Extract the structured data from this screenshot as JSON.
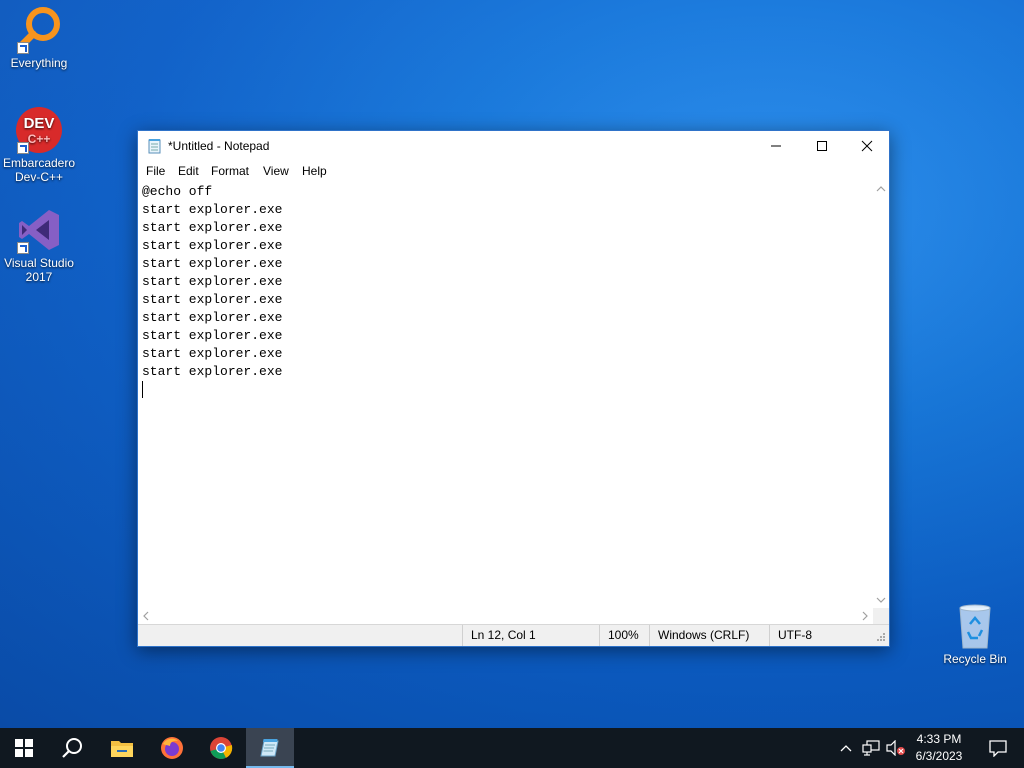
{
  "desktop": {
    "icons": [
      {
        "label": "Everything"
      },
      {
        "label": "Embarcadero Dev-C++"
      },
      {
        "label": "Visual Studio 2017"
      },
      {
        "label": "Recycle Bin"
      }
    ]
  },
  "notepad": {
    "title": "*Untitled - Notepad",
    "menu": [
      "File",
      "Edit",
      "Format",
      "View",
      "Help"
    ],
    "lines": [
      "@echo off",
      "start explorer.exe",
      "start explorer.exe",
      "start explorer.exe",
      "start explorer.exe",
      "start explorer.exe",
      "start explorer.exe",
      "start explorer.exe",
      "start explorer.exe",
      "start explorer.exe",
      "start explorer.exe"
    ],
    "status": {
      "position": "Ln 12, Col 1",
      "zoom": "100%",
      "line_ending": "Windows (CRLF)",
      "encoding": "UTF-8"
    }
  },
  "taskbar": {
    "time": "4:33 PM",
    "date": "6/3/2023"
  },
  "colors": {
    "accent": "#0078d7",
    "taskbar": "#101820"
  }
}
